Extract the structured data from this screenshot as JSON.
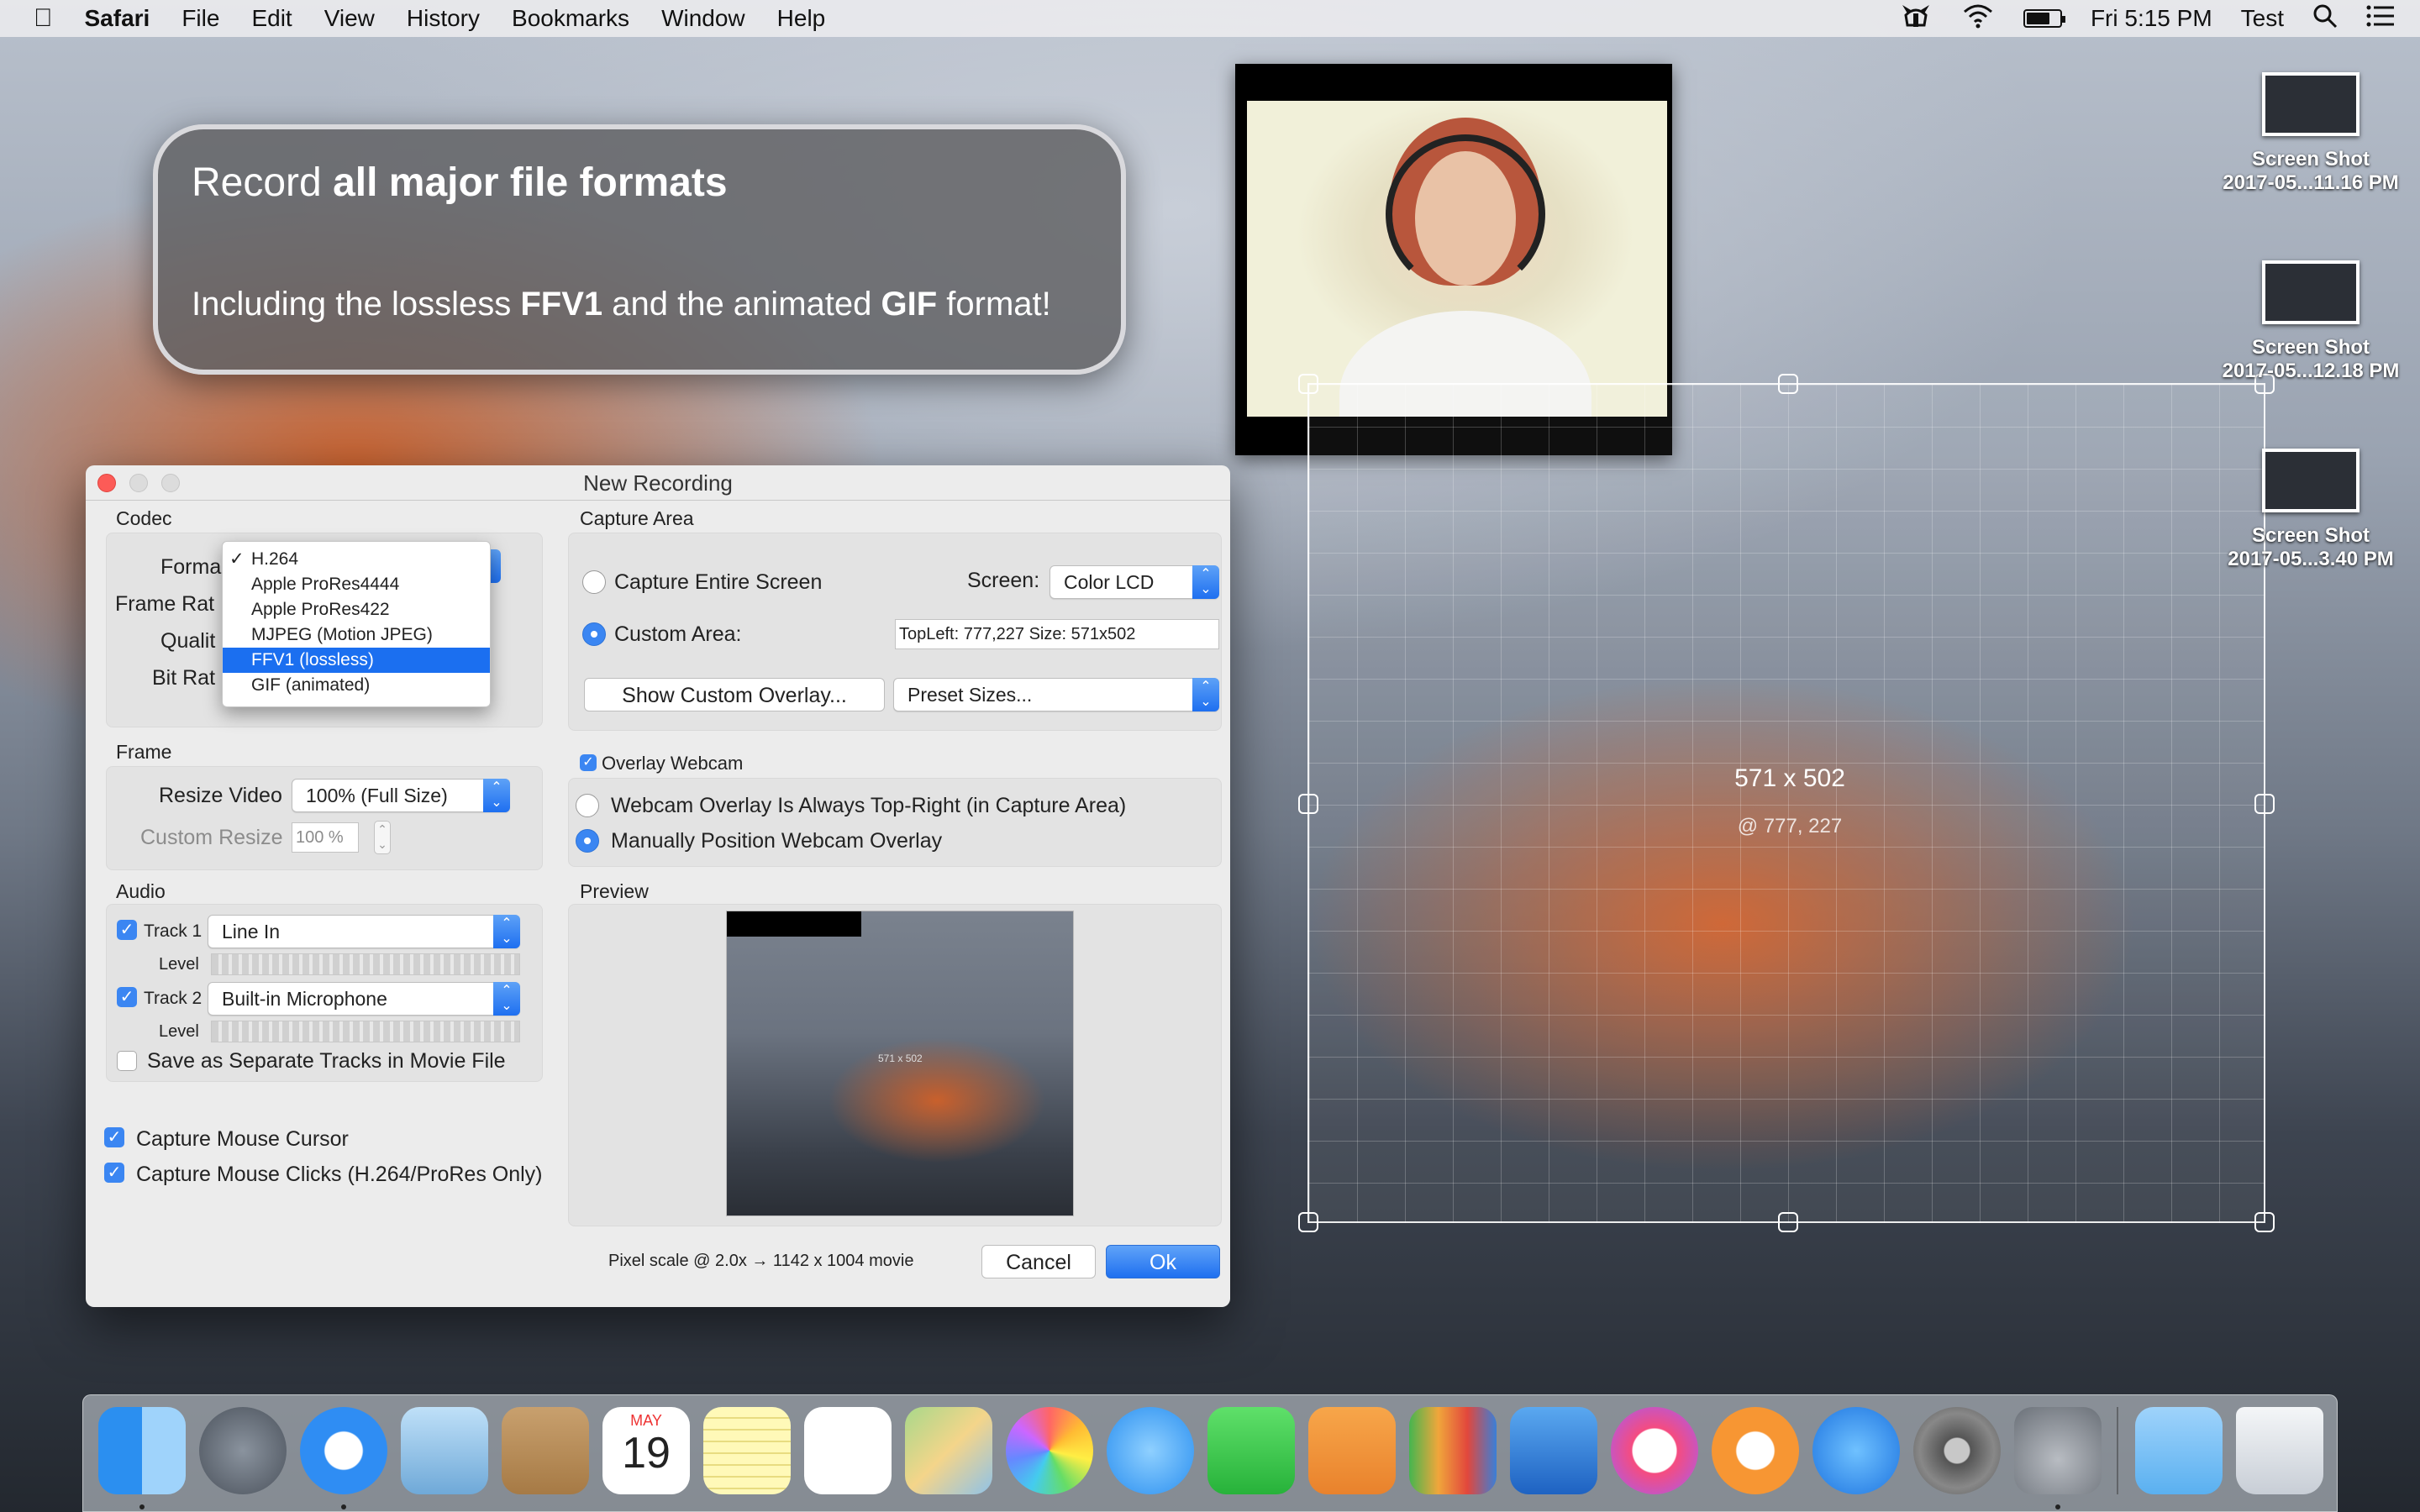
{
  "menubar": {
    "app": "Safari",
    "items": [
      "File",
      "Edit",
      "View",
      "History",
      "Bookmarks",
      "Window",
      "Help"
    ],
    "clock": "Fri 5:15 PM",
    "user": "Test",
    "battery_level": 0.7
  },
  "callout": {
    "line1_pre": "Record ",
    "line1_bold": "all major file formats",
    "line2_pre": "Including the lossless ",
    "line2_bold1": "FFV1",
    "line2_mid": " and the animated ",
    "line2_bold2": "GIF",
    "line2_post": " format!"
  },
  "selection": {
    "size": "571 x 502",
    "position": "@ 777, 227"
  },
  "desktop_files": [
    {
      "name": "Screen Shot",
      "sub": "2017-05...11.16 PM"
    },
    {
      "name": "Screen Shot",
      "sub": "2017-05...12.18 PM"
    },
    {
      "name": "Screen Shot",
      "sub": "2017-05...3.40 PM"
    }
  ],
  "window": {
    "title": "New Recording",
    "codec": {
      "header": "Codec",
      "format_label": "Forma",
      "framerate_label": "Frame Rat",
      "quality_label": "Qualit",
      "bitrate_label": "Bit Rat",
      "format_options": [
        "H.264",
        "Apple ProRes4444",
        "Apple ProRes422",
        "MJPEG (Motion JPEG)",
        "FFV1 (lossless)",
        "GIF (animated)"
      ],
      "format_checked": "H.264",
      "format_highlighted": "FFV1 (lossless)",
      "check_mark": "✓"
    },
    "capture_area": {
      "header": "Capture Area",
      "entire_screen": "Capture Entire Screen",
      "screen_label": "Screen:",
      "screen_value": "Color LCD",
      "custom_area": "Custom Area:",
      "custom_value": "TopLeft: 777,227  Size: 571x502",
      "show_overlay_btn": "Show Custom Overlay...",
      "preset_sizes": "Preset Sizes..."
    },
    "frame": {
      "header": "Frame",
      "resize_label": "Resize Video",
      "resize_value": "100% (Full Size)",
      "custom_label": "Custom Resize",
      "custom_value": "100 %"
    },
    "webcam": {
      "header": "Overlay Webcam",
      "opt1": "Webcam Overlay Is Always Top-Right (in Capture Area)",
      "opt2": "Manually Position Webcam Overlay"
    },
    "audio": {
      "header": "Audio",
      "track1_label": "Track 1",
      "track1_value": "Line In",
      "track2_label": "Track 2",
      "track2_value": "Built-in Microphone",
      "level_label": "Level",
      "separate": "Save as Separate Tracks in Movie File"
    },
    "preview": {
      "header": "Preview",
      "size": "571 x 502"
    },
    "mouse_cursor": "Capture Mouse Cursor",
    "mouse_clicks": "Capture Mouse Clicks (H.264/ProRes Only)",
    "pixel_scale": "Pixel scale @ 2.0x → 1142 x 1004 movie",
    "cancel": "Cancel",
    "ok": "Ok"
  },
  "dock": {
    "apps": [
      "finder-icon",
      "launchpad-icon",
      "safari-icon",
      "mail-icon",
      "contacts-icon",
      "calendar-icon",
      "notes-icon",
      "reminders-icon",
      "maps-icon",
      "photos-icon",
      "messages-icon",
      "facetime-icon",
      "pages-icon",
      "numbers-icon",
      "keynote-icon",
      "itunes-icon",
      "ibooks-icon",
      "app-store-icon",
      "system-preferences-icon",
      "screen-recorder-icon",
      "downloads-folder-icon",
      "trash-icon"
    ],
    "calendar_month": "MAY",
    "calendar_day": "19"
  }
}
